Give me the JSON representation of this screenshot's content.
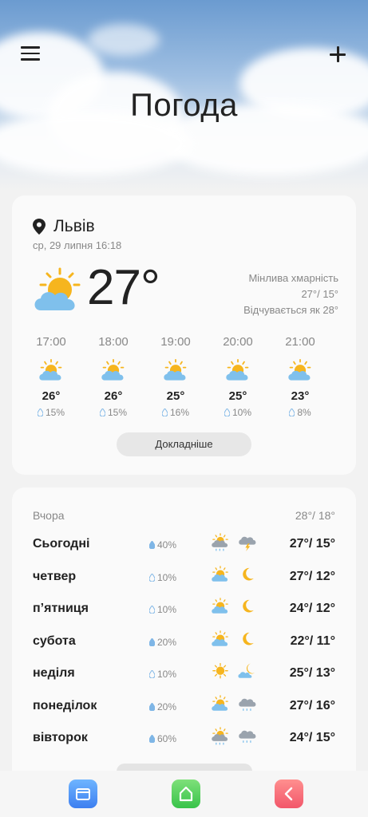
{
  "header": {
    "title": "Погода",
    "menu_icon": "hamburger-icon",
    "add_icon": "plus-icon"
  },
  "current": {
    "location": "Львів",
    "datetime": "ср, 29 липня 16:18",
    "temperature": "27°",
    "condition": "Мінлива хмарність",
    "high_low": "27°/ 15°",
    "feels_like": "Відчувається як 28°",
    "icon": "partly-sunny-icon"
  },
  "hourly": [
    {
      "time": "17:00",
      "temp": "26°",
      "precip": "15%",
      "icon": "partly-sunny-icon"
    },
    {
      "time": "18:00",
      "temp": "26°",
      "precip": "15%",
      "icon": "partly-sunny-icon"
    },
    {
      "time": "19:00",
      "temp": "25°",
      "precip": "16%",
      "icon": "partly-sunny-icon"
    },
    {
      "time": "20:00",
      "temp": "25°",
      "precip": "10%",
      "icon": "partly-sunny-icon"
    },
    {
      "time": "21:00",
      "temp": "23°",
      "precip": "8%",
      "icon": "partly-sunny-icon"
    }
  ],
  "details_label": "Докладніше",
  "daily": {
    "yesterday_label": "Вчора",
    "yesterday_temps": "28°/ 18°",
    "days": [
      {
        "name": "Сьогодні",
        "precip": "40%",
        "day_icon": "sun-rain-icon",
        "night_icon": "thunderstorm-icon",
        "temps": "27°/ 15°"
      },
      {
        "name": "четвер",
        "precip": "10%",
        "day_icon": "partly-sunny-icon",
        "night_icon": "moon-icon",
        "temps": "27°/ 12°"
      },
      {
        "name": "п’ятниця",
        "precip": "10%",
        "day_icon": "partly-sunny-icon",
        "night_icon": "moon-icon",
        "temps": "24°/ 12°"
      },
      {
        "name": "субота",
        "precip": "20%",
        "day_icon": "partly-sunny-icon",
        "night_icon": "moon-icon",
        "temps": "22°/ 11°"
      },
      {
        "name": "неділя",
        "precip": "10%",
        "day_icon": "sun-icon",
        "night_icon": "moon-cloud-icon",
        "temps": "25°/ 13°"
      },
      {
        "name": "понеділок",
        "precip": "20%",
        "day_icon": "partly-sunny-icon",
        "night_icon": "rain-cloud-icon",
        "temps": "27°/ 16°"
      },
      {
        "name": "вівторок",
        "precip": "60%",
        "day_icon": "sun-rain-icon",
        "night_icon": "rain-cloud-icon",
        "temps": "24°/ 15°"
      }
    ]
  },
  "colors": {
    "sun": "#f6b51e",
    "cloud": "#7fc0ec",
    "drop": "#7fb6e6",
    "night_cloud": "#9aa3ad"
  },
  "nav": {
    "recent_icon": "recent-apps-icon",
    "home_icon": "home-icon",
    "back_icon": "back-icon"
  }
}
